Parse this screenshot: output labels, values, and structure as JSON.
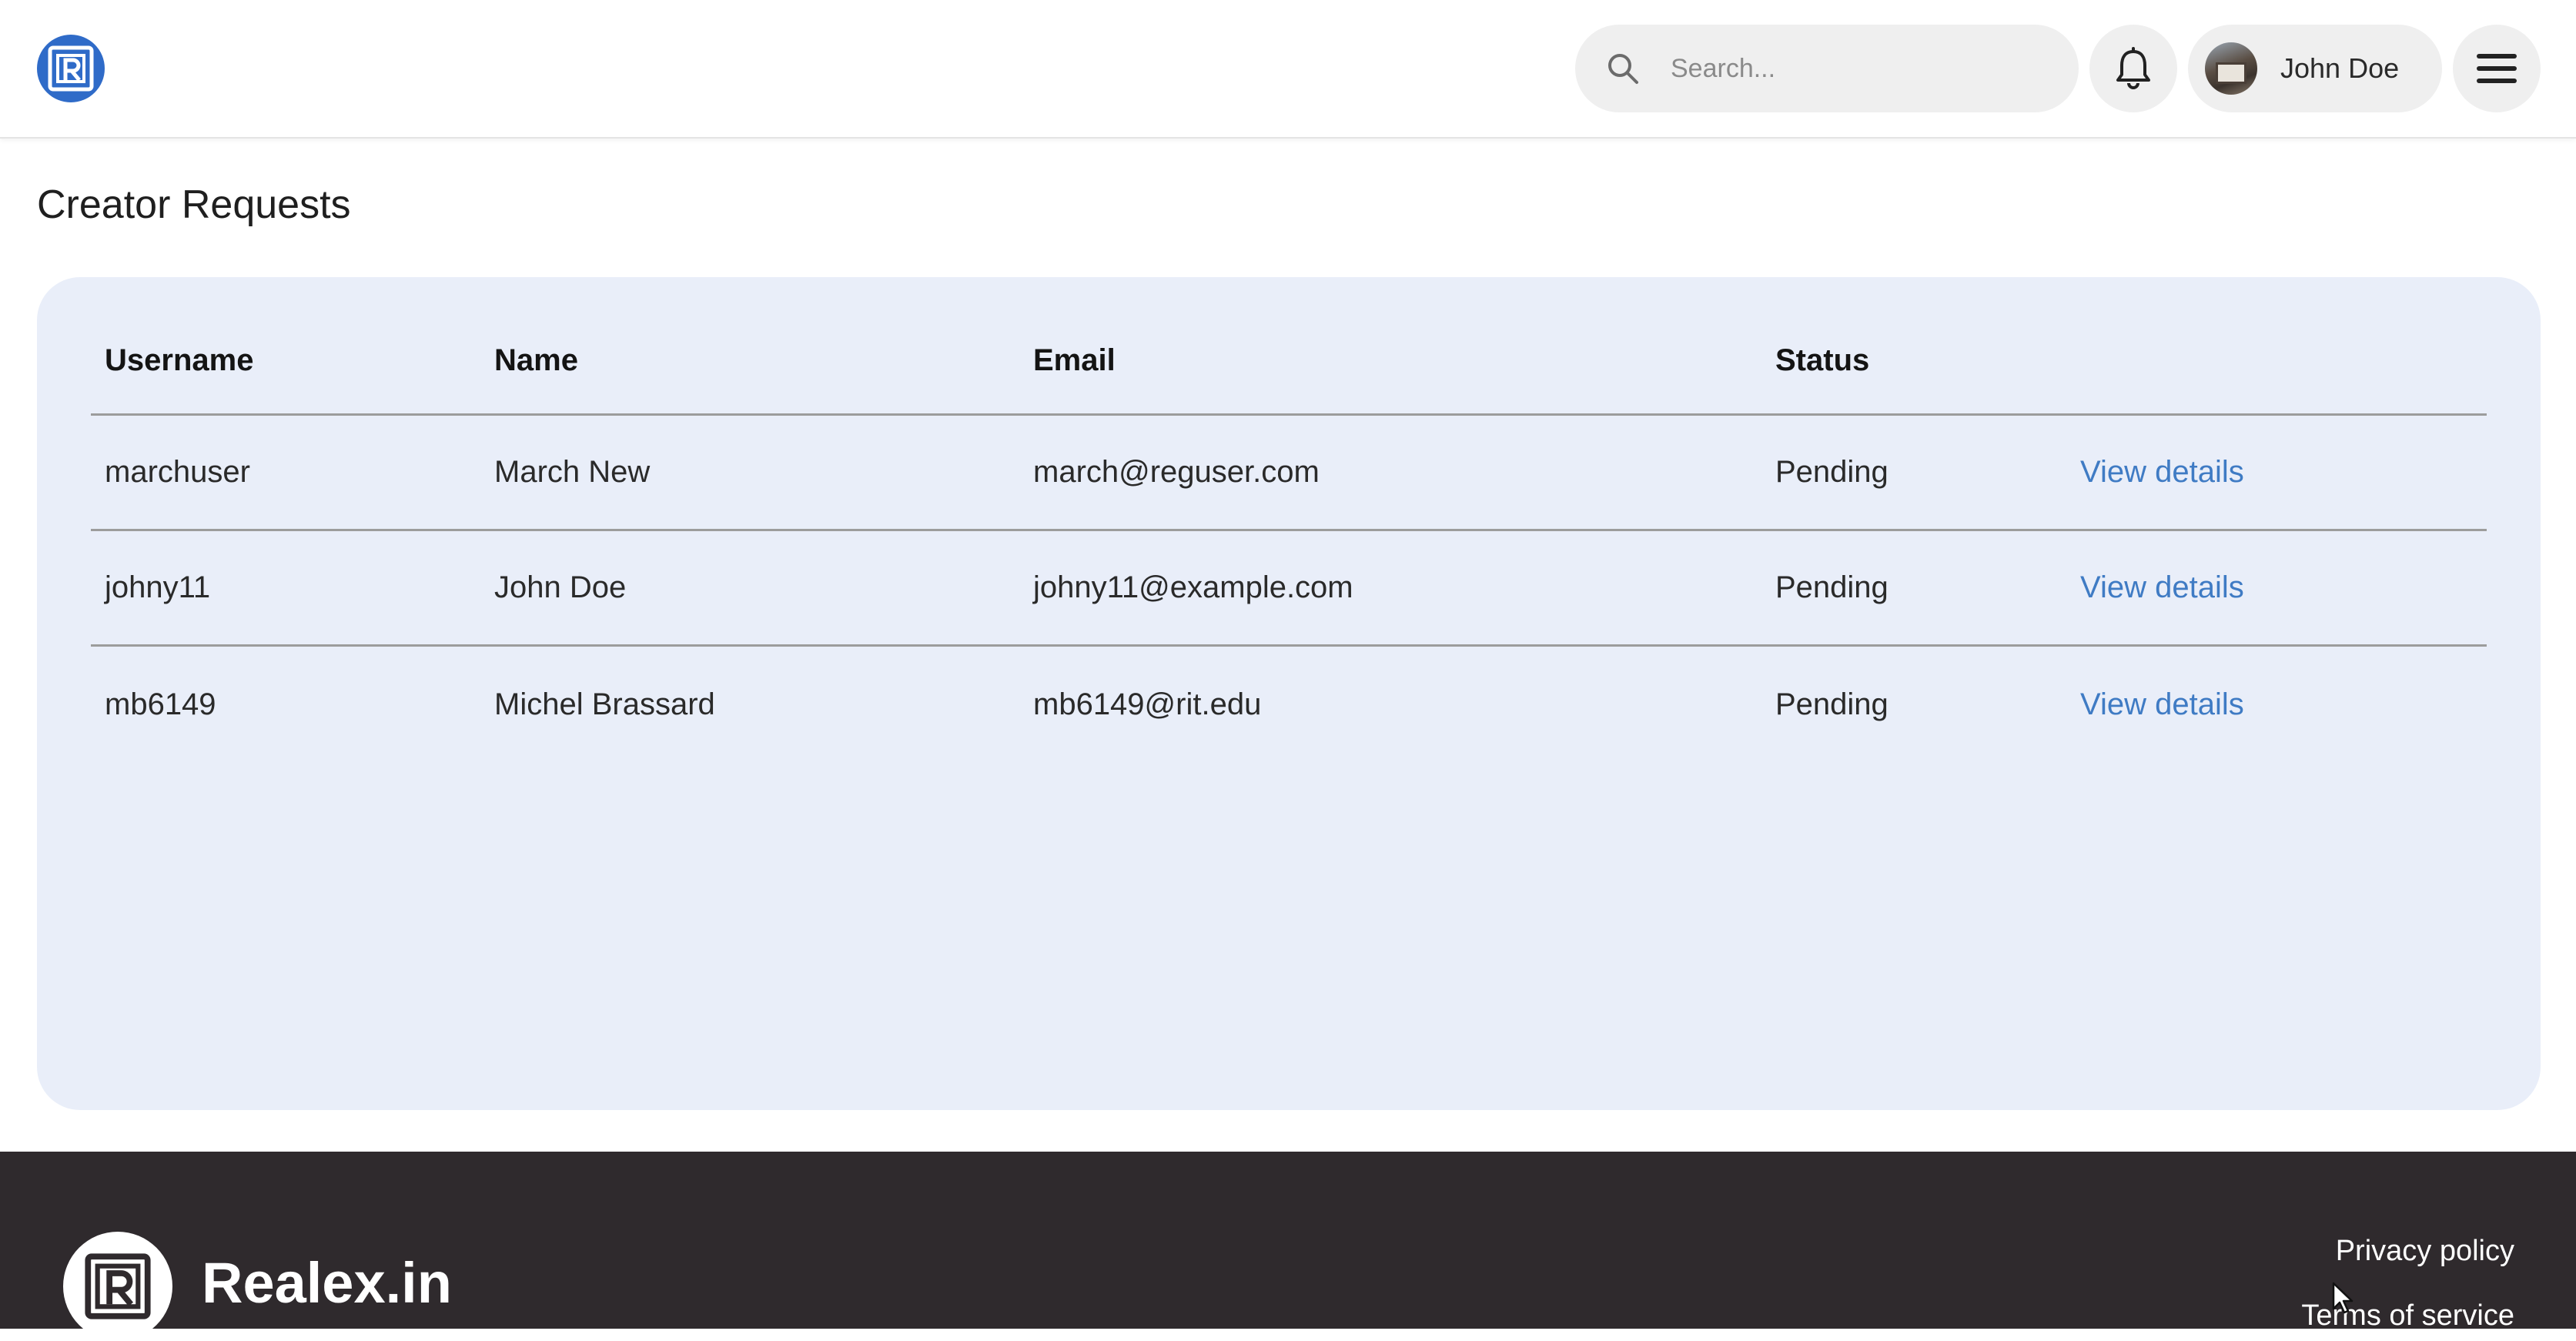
{
  "header": {
    "search": {
      "placeholder": "Search..."
    },
    "user": {
      "name": "John Doe"
    }
  },
  "main": {
    "title": "Creator Requests",
    "table": {
      "headers": {
        "username": "Username",
        "name": "Name",
        "email": "Email",
        "status": "Status"
      },
      "rows": [
        {
          "username": "marchuser",
          "name": "March New",
          "email": "march@reguser.com",
          "status": "Pending",
          "action": "View details"
        },
        {
          "username": "johny11",
          "name": "John Doe",
          "email": "johny11@example.com",
          "status": "Pending",
          "action": "View details"
        },
        {
          "username": "mb6149",
          "name": "Michel Brassard",
          "email": "mb6149@rit.edu",
          "status": "Pending",
          "action": "View details"
        }
      ]
    }
  },
  "footer": {
    "brand": "Realex.in",
    "links": {
      "privacy": "Privacy policy",
      "terms": "Terms of service"
    }
  },
  "colors": {
    "accent": "#2f6bc8",
    "link": "#3f7bc4",
    "card_background": "#e9eef9",
    "footer_background": "#2f2a2d"
  },
  "icons": {
    "logo": "realex-logo-icon",
    "search": "search-icon",
    "notifications": "bell-icon",
    "menu": "hamburger-menu-icon"
  }
}
